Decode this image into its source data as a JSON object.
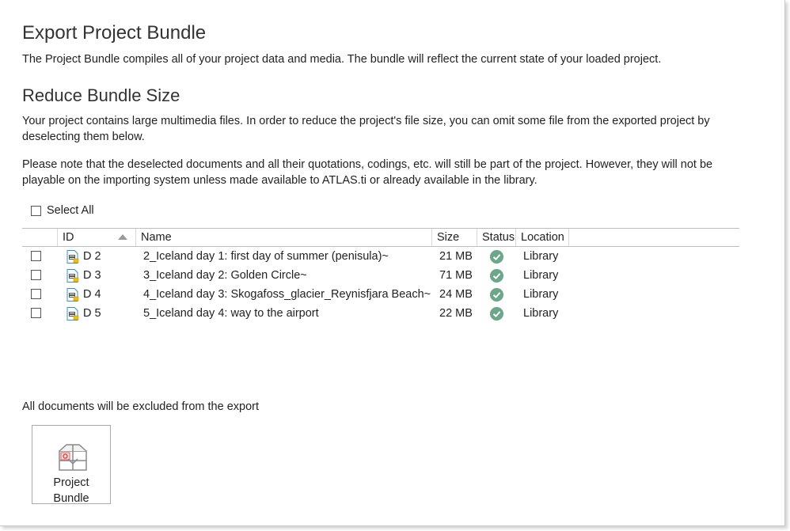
{
  "header": {
    "title": "Export Project Bundle",
    "description": "The Project Bundle compiles all of your project data and media. The bundle will reflect the current state of your loaded project."
  },
  "reduce": {
    "title": "Reduce Bundle Size",
    "paragraph1": "Your project contains large multimedia files. In order to reduce the project's file size, you can omit some file from the exported project by deselecting them below.",
    "paragraph2": "Please note that the deselected documents and all their quotations, codings, etc. will still be part of the project. However, they will not be playable on the importing system unless made available to ATLAS.ti or already available in the library.",
    "select_all_label": "Select All",
    "select_all_checked": false
  },
  "table": {
    "columns": {
      "id": "ID",
      "name": "Name",
      "size": "Size",
      "status": "Status",
      "location": "Location"
    },
    "sorted_by": "ID",
    "sort_direction": "ascending",
    "rows": [
      {
        "id": "D 2",
        "name": "2_Iceland day 1: first day of summer (penisula)~",
        "size": "21 MB",
        "status": "ok",
        "location": "Library",
        "checked": false
      },
      {
        "id": "D 3",
        "name": "3_Iceland day 2: Golden Circle~",
        "size": "71 MB",
        "status": "ok",
        "location": "Library",
        "checked": false
      },
      {
        "id": "D 4",
        "name": "4_Iceland day 3: Skogafoss_glacier_Reynisfjara Beach~",
        "size": "24 MB",
        "status": "ok",
        "location": "Library",
        "checked": false
      },
      {
        "id": "D 5",
        "name": "5_Iceland day 4: way to the airport",
        "size": "22 MB",
        "status": "ok",
        "location": "Library",
        "checked": false
      }
    ]
  },
  "footer": {
    "note": "All documents will be excluded from the export",
    "bundle_button_line1": "Project",
    "bundle_button_line2": "Bundle"
  },
  "colors": {
    "status_ok": "#6aa889",
    "doc_icon": "#3a8fd0",
    "border": "#bdbdbd"
  },
  "icons": {
    "document": "video-document-icon",
    "status": "check-circle-icon",
    "sort": "sort-ascending-icon",
    "bundle": "project-bundle-icon"
  }
}
